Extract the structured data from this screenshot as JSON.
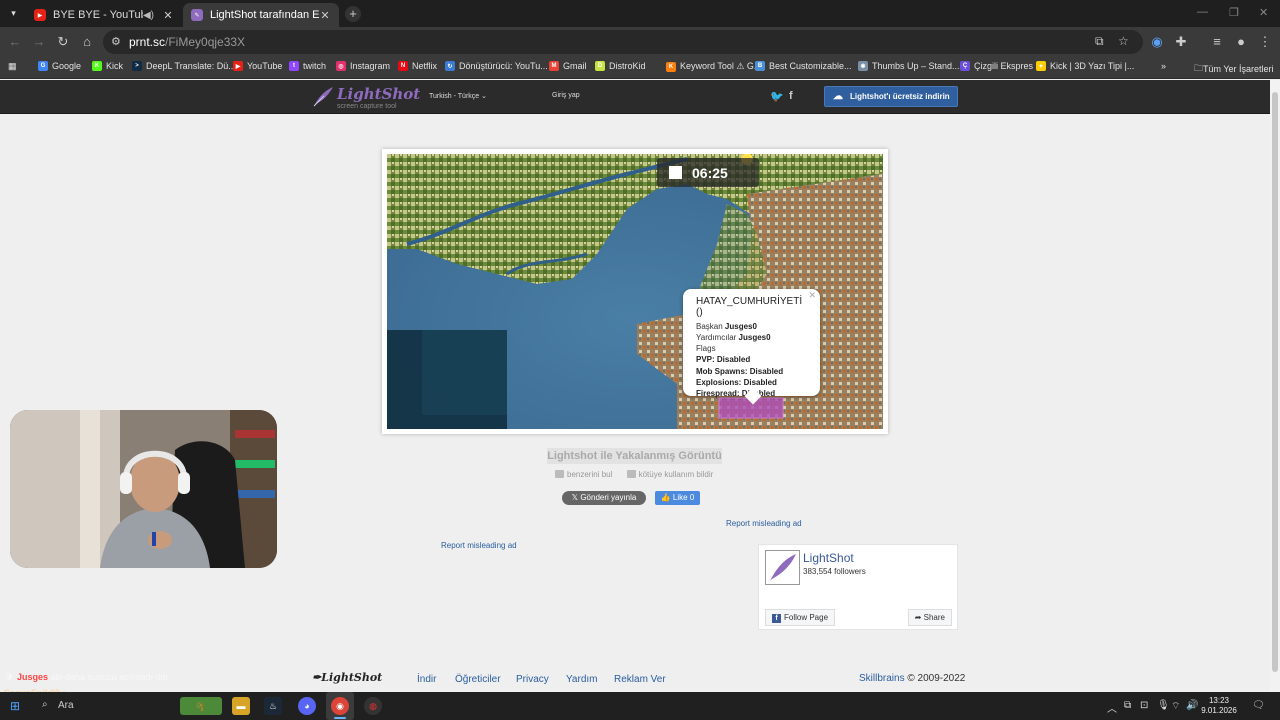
{
  "browser": {
    "tabs": [
      {
        "title": "BYE BYE - YouTube",
        "active": false,
        "favicon_color": "#e62117"
      },
      {
        "title": "LightShot tarafından Ekran Görüntüsü",
        "active": true,
        "favicon_color": "#8e6bbd"
      }
    ],
    "url_host": "prnt.sc",
    "url_path": "/FiMey0qje33X",
    "bookmarks": [
      {
        "label": "Google",
        "icon_color": "#4285f4",
        "glyph": "G"
      },
      {
        "label": "Kick",
        "icon_color": "#53fc18",
        "glyph": "K"
      },
      {
        "label": "DeepL Translate: Dü...",
        "icon_color": "#0f2b46",
        "glyph": ">"
      },
      {
        "label": "YouTube",
        "icon_color": "#e62117",
        "glyph": "▶"
      },
      {
        "label": "twitch",
        "icon_color": "#9146ff",
        "glyph": "t"
      },
      {
        "label": "Instagram",
        "icon_color": "#e1306c",
        "glyph": "◎"
      },
      {
        "label": "Netflix",
        "icon_color": "#e50914",
        "glyph": "N"
      },
      {
        "label": "Dönüştürücü: YouTu...",
        "icon_color": "#3a7bd5",
        "glyph": "↻"
      },
      {
        "label": "Gmail",
        "icon_color": "#ea4335",
        "glyph": "M"
      },
      {
        "label": "DistroKid",
        "icon_color": "#c7e342",
        "glyph": "D"
      },
      {
        "label": "Keyword Tool ⚠ G...",
        "icon_color": "#ff7f0e",
        "glyph": "K"
      },
      {
        "label": "Best Customizable...",
        "icon_color": "#4a90d9",
        "glyph": "B"
      },
      {
        "label": "Thumbs Up – Stand...",
        "icon_color": "#7a8fa6",
        "glyph": "✱"
      },
      {
        "label": "Çizgili Ekspres",
        "icon_color": "#6b4fd8",
        "glyph": "Ç"
      },
      {
        "label": "Kick | 3D Yazı Tipi |...",
        "icon_color": "#ffcc00",
        "glyph": "✦"
      }
    ],
    "all_bookmarks_label": "Tüm Yer İşaretleri"
  },
  "lightshot": {
    "logo_name": "LightShot",
    "logo_sub": "screen capture tool",
    "language": "Turkish - Türkçe",
    "login": "Giriş yap",
    "download_button": "Lightshot'ı ücretsiz indirin",
    "timer": "06:25",
    "popup": {
      "title": "HATAY_CUMHURİYETİ ()",
      "leader_label": "Başkan",
      "leader_value": "Jusges0",
      "helpers_label": "Yardımcılar",
      "helpers_value": "Jusges0",
      "flags_label": "Flags",
      "pvp": "PVP: Disabled",
      "mobs": "Mob Spawns: Disabled",
      "explosions": "Explosions: Disabled",
      "firespread": "Firespread: Disabled"
    },
    "caption": "Lightshot ile Yakalanmış Görüntü",
    "find_similar": "benzerini bul",
    "report_abuse": "kötüye kullanım bildir",
    "tweet_button": "Gönderi yayınla",
    "like_button": "Like 0",
    "report_ad_right": "Report misleading ad",
    "report_ad_left": "Report misleading ad",
    "facebook": {
      "page_name": "LightShot",
      "followers": "383,554 followers",
      "follow_button": "Follow Page",
      "share_button": "Share"
    },
    "footer": {
      "logo": "LightShot",
      "links": [
        "İndir",
        "Öğreticiler",
        "Privacy",
        "Yardım",
        "Reklam Ver"
      ],
      "skillbrains": "Skillbrains",
      "copyright": "© 2009-2022"
    }
  },
  "overlay": {
    "chat_user": "Jusges",
    "chat_message": "abi daha sunucu açılmadı dio",
    "chat_line2": "SenyoEpik08 :"
  },
  "taskbar": {
    "search_placeholder": "Ara",
    "time": "13:23",
    "date": "9.01.2026"
  }
}
